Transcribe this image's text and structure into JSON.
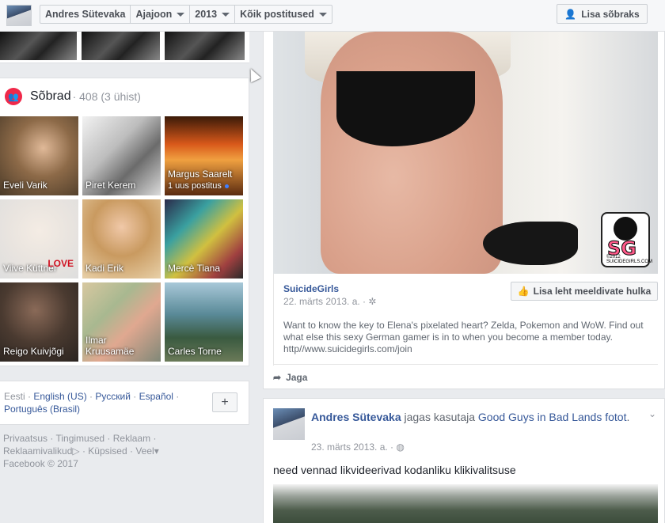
{
  "header": {
    "profile_name": "Andres Sütevaka",
    "timeline_label": "Ajajoon",
    "year_label": "2013",
    "filter_label": "Kõik postitused",
    "add_friend_label": "Lisa sõbraks"
  },
  "friends": {
    "title": "Sõbrad",
    "count": "· 408 (3 ühist)",
    "items": [
      {
        "name": "Eveli Varik",
        "subtext": ""
      },
      {
        "name": "Piret Kerem",
        "subtext": ""
      },
      {
        "name": "Margus Saarelt",
        "subtext": "1 uus postitus"
      },
      {
        "name": "Viive Küttner",
        "subtext": ""
      },
      {
        "name": "Kadi Erik",
        "subtext": ""
      },
      {
        "name": "Mercè Tiana",
        "subtext": ""
      },
      {
        "name": "Reigo Kuivjõgi",
        "subtext": ""
      },
      {
        "name": "Ilmar Kruusamäe",
        "subtext": ""
      },
      {
        "name": "Carles Torne",
        "subtext": ""
      }
    ]
  },
  "languages": {
    "current": "Eesti",
    "options": [
      "English (US)",
      "Русский",
      "Español",
      "Português (Brasil)"
    ],
    "add_label": "+"
  },
  "footer": {
    "links": [
      "Privaatsus",
      "Tingimused",
      "Reklaam",
      "Reklaamivalikud",
      "Küpsised",
      "Veel"
    ],
    "copyright": "Facebook © 2017"
  },
  "post1": {
    "source": "SuicideGirls",
    "date": "22. märts 2013. a. ·",
    "like_page_label": "Lisa leht meeldivate hulka",
    "description": "Want to know the key to Elena's pixelated heart? Zelda, Pokemon and WoW. Find out what else this sexy German gamer is in to when you become a member today. http//www.suicidegirls.com/join",
    "share_label": "Jaga",
    "logo_text": "SG",
    "logo_year": "©2012 SUICIDEGIRLS.COM"
  },
  "post2": {
    "author": "Andres Sütevaka",
    "action": "jagas kasutaja",
    "shared_from": "Good Guys in Bad Lands",
    "object": "fotot",
    "date": "23. märts 2013. a. ·",
    "text": "need vennad likvideerivad kodanliku klikivalitsuse"
  },
  "colors": {
    "link": "#365899",
    "friends_icon": "#f02849",
    "unread_dot": "#4080ff"
  }
}
